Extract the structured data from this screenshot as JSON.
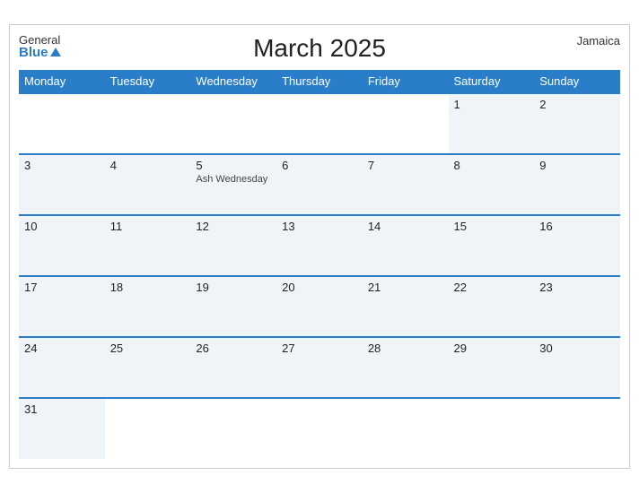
{
  "header": {
    "brand_general": "General",
    "brand_blue": "Blue",
    "title": "March 2025",
    "region": "Jamaica"
  },
  "weekdays": [
    "Monday",
    "Tuesday",
    "Wednesday",
    "Thursday",
    "Friday",
    "Saturday",
    "Sunday"
  ],
  "weeks": [
    [
      {
        "day": "",
        "event": ""
      },
      {
        "day": "",
        "event": ""
      },
      {
        "day": "",
        "event": ""
      },
      {
        "day": "",
        "event": ""
      },
      {
        "day": "",
        "event": ""
      },
      {
        "day": "1",
        "event": ""
      },
      {
        "day": "2",
        "event": ""
      }
    ],
    [
      {
        "day": "3",
        "event": ""
      },
      {
        "day": "4",
        "event": ""
      },
      {
        "day": "5",
        "event": "Ash Wednesday"
      },
      {
        "day": "6",
        "event": ""
      },
      {
        "day": "7",
        "event": ""
      },
      {
        "day": "8",
        "event": ""
      },
      {
        "day": "9",
        "event": ""
      }
    ],
    [
      {
        "day": "10",
        "event": ""
      },
      {
        "day": "11",
        "event": ""
      },
      {
        "day": "12",
        "event": ""
      },
      {
        "day": "13",
        "event": ""
      },
      {
        "day": "14",
        "event": ""
      },
      {
        "day": "15",
        "event": ""
      },
      {
        "day": "16",
        "event": ""
      }
    ],
    [
      {
        "day": "17",
        "event": ""
      },
      {
        "day": "18",
        "event": ""
      },
      {
        "day": "19",
        "event": ""
      },
      {
        "day": "20",
        "event": ""
      },
      {
        "day": "21",
        "event": ""
      },
      {
        "day": "22",
        "event": ""
      },
      {
        "day": "23",
        "event": ""
      }
    ],
    [
      {
        "day": "24",
        "event": ""
      },
      {
        "day": "25",
        "event": ""
      },
      {
        "day": "26",
        "event": ""
      },
      {
        "day": "27",
        "event": ""
      },
      {
        "day": "28",
        "event": ""
      },
      {
        "day": "29",
        "event": ""
      },
      {
        "day": "30",
        "event": ""
      }
    ],
    [
      {
        "day": "31",
        "event": ""
      },
      {
        "day": "",
        "event": ""
      },
      {
        "day": "",
        "event": ""
      },
      {
        "day": "",
        "event": ""
      },
      {
        "day": "",
        "event": ""
      },
      {
        "day": "",
        "event": ""
      },
      {
        "day": "",
        "event": ""
      }
    ]
  ]
}
